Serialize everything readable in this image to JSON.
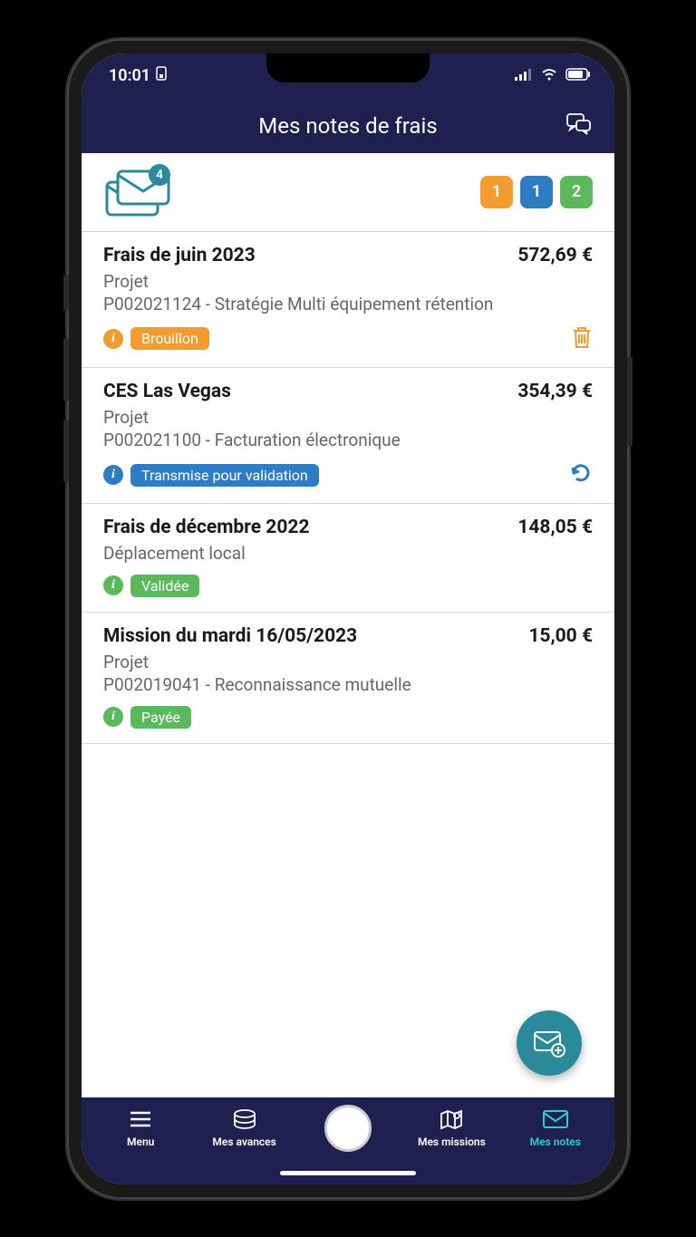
{
  "statusbar": {
    "time": "10:01"
  },
  "header": {
    "title": "Mes notes de frais"
  },
  "summary": {
    "envelope_count": "4",
    "chips": {
      "orange": "1",
      "blue": "1",
      "green": "2"
    }
  },
  "items": [
    {
      "title": "Frais de juin 2023",
      "amount": "572,69 €",
      "subtitle1": "Projet",
      "subtitle2": "P002021124 - Stratégie Multi équipement rétention",
      "status_label": "Brouillon",
      "status_color": "orange",
      "action": "delete"
    },
    {
      "title": "CES Las Vegas",
      "amount": "354,39 €",
      "subtitle1": "Projet",
      "subtitle2": "P002021100 - Facturation électronique",
      "status_label": "Transmise pour validation",
      "status_color": "blue",
      "action": "undo"
    },
    {
      "title": "Frais de décembre 2022",
      "amount": "148,05 €",
      "subtitle1": "Déplacement local",
      "subtitle2": "",
      "status_label": "Validée",
      "status_color": "green",
      "action": ""
    },
    {
      "title": "Mission du mardi 16/05/2023",
      "amount": "15,00 €",
      "subtitle1": "Projet",
      "subtitle2": "P002019041 - Reconnaissance mutuelle",
      "status_label": "Payée",
      "status_color": "green",
      "action": ""
    }
  ],
  "nav": {
    "menu": "Menu",
    "avances": "Mes avances",
    "missions": "Mes missions",
    "notes": "Mes notes"
  }
}
